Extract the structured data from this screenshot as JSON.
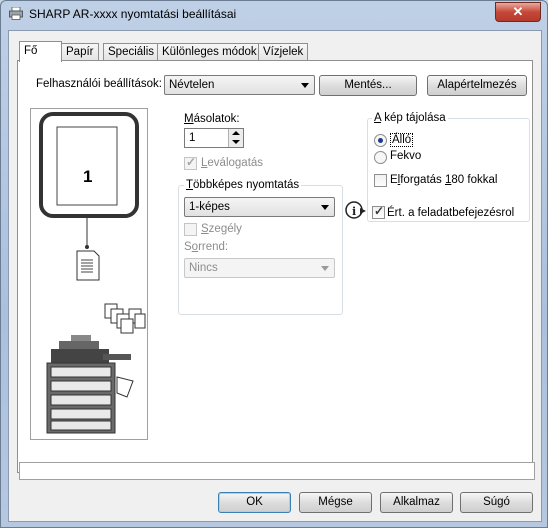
{
  "window": {
    "title": "SHARP AR-xxxx nyomtatási beállításai",
    "close_label": "✕"
  },
  "tabs": [
    {
      "label": "Fő",
      "active": true
    },
    {
      "label": "Papír"
    },
    {
      "label": "Speciális"
    },
    {
      "label": "Különleges módok"
    },
    {
      "label": "Vízjelek"
    }
  ],
  "user_settings": {
    "label": "Felhasználói beállítások:",
    "value": "Névtelen",
    "save_button": "Mentés...",
    "defaults_button": "Alapértelmezés"
  },
  "preview": {
    "page_number": "1"
  },
  "copies": {
    "label": "Másolatok:",
    "value": "1",
    "collate_label": "Leválogatás",
    "collate_checked": true,
    "collate_enabled": false
  },
  "multipage": {
    "title": "Többképes nyomtatás",
    "value": "1-képes",
    "border_label": "Szegély",
    "border_checked": false,
    "order_label": "Sorrend:",
    "order_value": "Nincs"
  },
  "orientation": {
    "title": "A kép tájolása",
    "options": [
      {
        "label": "Álló",
        "selected": true
      },
      {
        "label": "Fekvo",
        "selected": false
      }
    ],
    "rotate_label": "Elforgatás 180 fokkal",
    "rotate_checked": false
  },
  "notify": {
    "label": "Ért. a feladatbefejezésrol",
    "checked": true
  },
  "buttons": {
    "ok": "OK",
    "cancel": "Mégse",
    "apply": "Alkalmaz",
    "help": "Súgó"
  },
  "colors": {
    "window_frame": "#aac0dc",
    "close_button": "#c5493a",
    "default_button_border": "#3c7fb1",
    "selection": "#1f3a8a"
  },
  "icons": [
    "printer-icon",
    "document-icon",
    "collated-copies-icon",
    "copier-machine-icon",
    "info-icon"
  ]
}
